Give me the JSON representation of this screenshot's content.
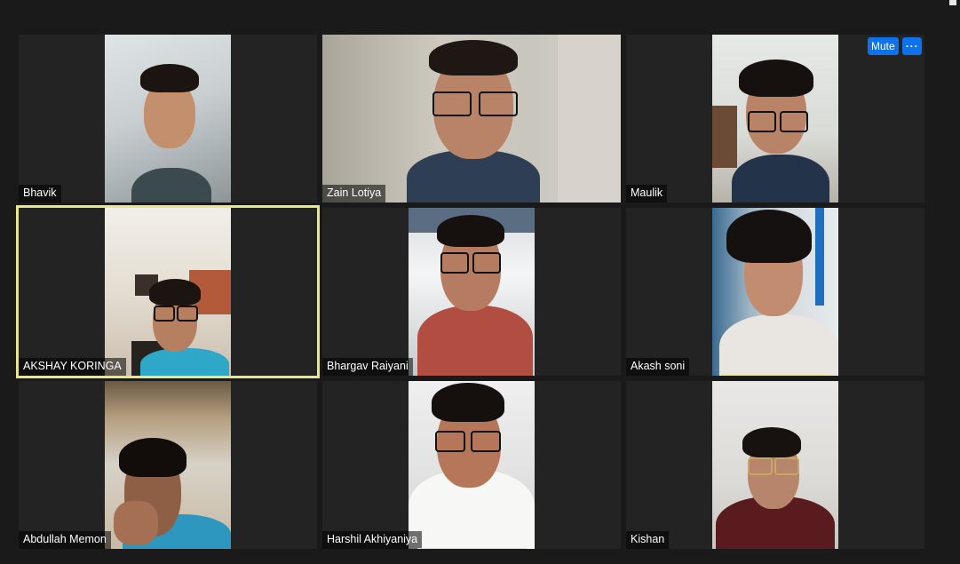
{
  "window": {
    "top_controls": {
      "mute_label": "Mute",
      "more_label": "···"
    }
  },
  "participants": [
    {
      "name": "Bhavik",
      "speaking": false
    },
    {
      "name": "Zain Lotiya",
      "speaking": false
    },
    {
      "name": "Maulik",
      "speaking": false
    },
    {
      "name": "AKSHAY KORINGA",
      "speaking": true
    },
    {
      "name": "Bhargav Raiyani",
      "speaking": false
    },
    {
      "name": "Akash soni",
      "speaking": false
    },
    {
      "name": "Abdullah Memon",
      "speaking": false
    },
    {
      "name": "Harshil Akhiyaniya",
      "speaking": false
    },
    {
      "name": "Kishan",
      "speaking": false
    }
  ],
  "colors": {
    "background": "#1a1a1a",
    "tile": "#232323",
    "speaker_outline": "#e8e689",
    "button_blue": "#0e72ed"
  }
}
